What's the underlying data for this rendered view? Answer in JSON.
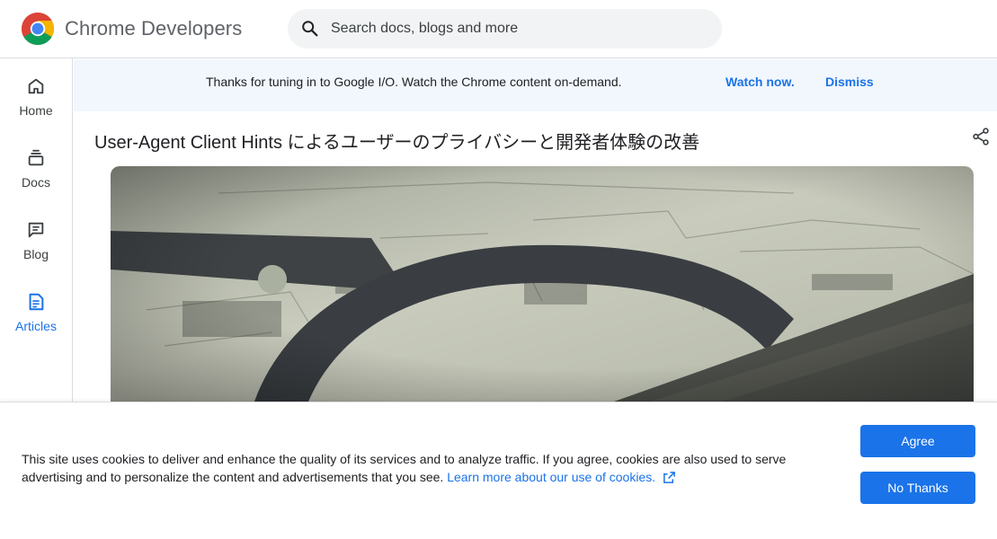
{
  "header": {
    "brand": "Chrome Developers",
    "logo_icon": "chrome-logo",
    "search": {
      "placeholder": "Search docs, blogs and more",
      "icon": "search-icon"
    }
  },
  "sidebar": {
    "items": [
      {
        "label": "Home",
        "icon": "home-icon",
        "active": false
      },
      {
        "label": "Docs",
        "icon": "docs-stack-icon",
        "active": false
      },
      {
        "label": "Blog",
        "icon": "blog-comment-icon",
        "active": false
      },
      {
        "label": "Articles",
        "icon": "article-icon",
        "active": true
      }
    ]
  },
  "banner": {
    "text": "Thanks for tuning in to Google I/O. Watch the Chrome content on-demand.",
    "watch_label": "Watch now.",
    "dismiss_label": "Dismiss"
  },
  "article": {
    "title": "User-Agent Client Hints によるユーザーのプライバシーと開発者体験の改善",
    "share_icon": "share-icon"
  },
  "cookie": {
    "text": "This site uses cookies to deliver and enhance the quality of its services and to analyze traffic. If you agree, cookies are also used to serve advertising and to personalize the content and advertisements that you see.",
    "link": "Learn more about our use of cookies.",
    "agree_label": "Agree",
    "no_thanks_label": "No Thanks"
  },
  "colors": {
    "accent": "#1a73e8",
    "banner_bg": "#f2f7fd",
    "search_bg": "#f1f3f4",
    "border": "#dadce0"
  }
}
